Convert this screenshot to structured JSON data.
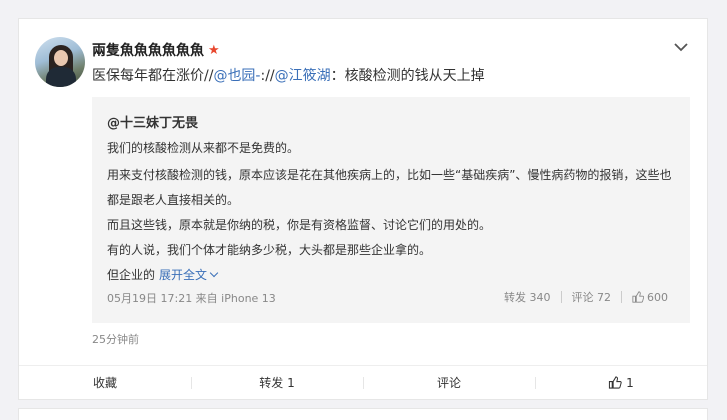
{
  "post": {
    "username": "兩隻魚魚魚魚魚魚",
    "badge_icon": "star-icon",
    "text_before": "医保每年都在涨价//",
    "mention1": "@也园-",
    "text_mid": "://",
    "mention2": "@江筱湖",
    "text_after": "：核酸检测的钱从天上掉",
    "time": "25分钟前"
  },
  "quote": {
    "author": "@十三妹丁无畏",
    "lines": [
      "我们的核酸检测从来都不是免费的。",
      "用来支付核酸检测的钱，原本应该是花在其他疾病上的，比如一些“基础疾病”、慢性病药物的报销，这些也",
      "都是跟老人直接相关的。",
      "而且这些钱，原本就是你纳的税，你是有资格监督、讨论它们的用处的。",
      "有的人说，我们个体才能纳多少税，大头都是那些企业拿的。",
      "但企业的"
    ],
    "expand_label": "展开全文",
    "meta": "05月19日 17:21 来自 iPhone 13",
    "repost": "转发 340",
    "comment": "评论 72",
    "likes": "600"
  },
  "actions": {
    "collect": "收藏",
    "repost": "转发 1",
    "comment": "评论",
    "like": "1"
  }
}
